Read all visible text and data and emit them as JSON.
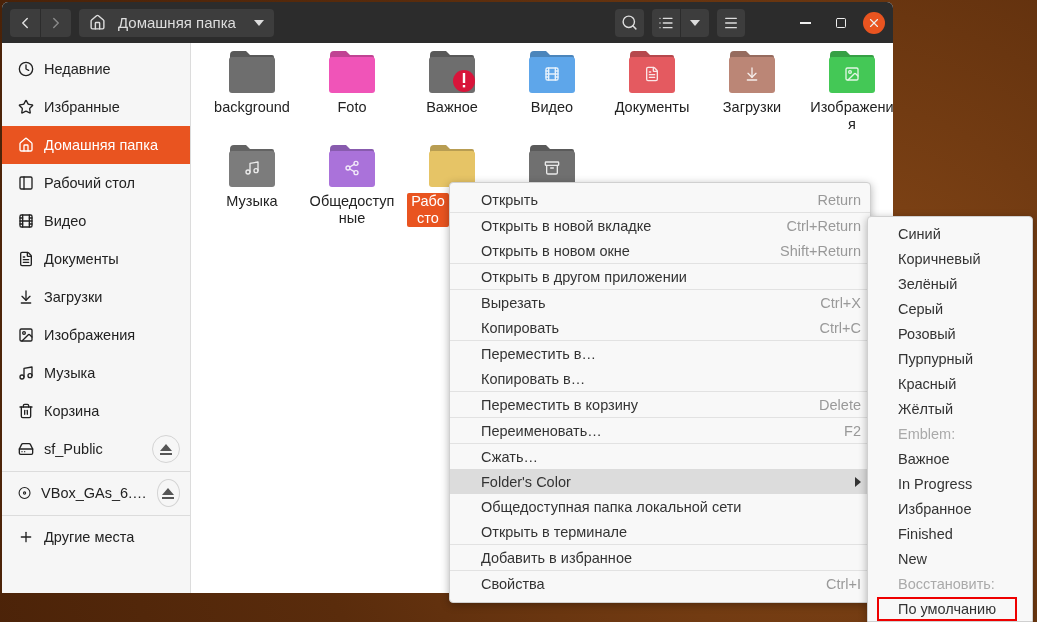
{
  "header": {
    "path": "Домашняя папка"
  },
  "sidebar": {
    "sections": [
      [
        {
          "label": "Недавние",
          "selected": false,
          "eject": false
        },
        {
          "label": "Избранные",
          "selected": false,
          "eject": false
        },
        {
          "label": "Домашняя папка",
          "selected": true,
          "eject": false
        },
        {
          "label": "Рабочий стол",
          "selected": false,
          "eject": false
        },
        {
          "label": "Видео",
          "selected": false,
          "eject": false
        },
        {
          "label": "Документы",
          "selected": false,
          "eject": false
        },
        {
          "label": "Загрузки",
          "selected": false,
          "eject": false
        },
        {
          "label": "Изображения",
          "selected": false,
          "eject": false
        },
        {
          "label": "Музыка",
          "selected": false,
          "eject": false
        },
        {
          "label": "Корзина",
          "selected": false,
          "eject": false
        },
        {
          "label": "sf_Public",
          "selected": false,
          "eject": true
        }
      ],
      [
        {
          "label": "VBox_GAs_6.…",
          "selected": false,
          "eject": true
        }
      ],
      [
        {
          "label": "Другие места",
          "selected": false,
          "eject": false
        }
      ]
    ]
  },
  "folders": [
    {
      "label": "background",
      "color": "#6e6e6e",
      "selected": false,
      "emblem": false
    },
    {
      "label": "Foto",
      "color": "#f054b8",
      "selected": false,
      "emblem": false
    },
    {
      "label": "Важное",
      "color": "#6e6e6e",
      "selected": false,
      "emblem": true
    },
    {
      "label": "Видео",
      "color": "#5ea6ea",
      "selected": false,
      "emblem": false
    },
    {
      "label": "Документы",
      "color": "#e45a60",
      "selected": false,
      "emblem": false
    },
    {
      "label": "Загрузки",
      "color": "#bb8676",
      "selected": false,
      "emblem": false
    },
    {
      "label": "Изображения",
      "color": "#44c856",
      "selected": false,
      "emblem": false
    },
    {
      "label": "Музыка",
      "color": "#7c7c7c",
      "selected": false,
      "emblem": false
    },
    {
      "label": "Общедоступные",
      "color": "#aa72da",
      "selected": false,
      "emblem": false
    },
    {
      "label": "Рабо сто",
      "color": "#e6c466",
      "selected": true,
      "emblem": false
    },
    {
      "color": "#707070",
      "emblem": false
    }
  ],
  "context_menu": {
    "groups": [
      [
        {
          "label": "Открыть",
          "shortcut": "Return",
          "selected": false,
          "submenu": false
        }
      ],
      [
        {
          "label": "Открыть в новой вкладке",
          "shortcut": "Ctrl+Return",
          "selected": false,
          "submenu": false
        },
        {
          "label": "Открыть в новом окне",
          "shortcut": "Shift+Return",
          "selected": false,
          "submenu": false
        }
      ],
      [
        {
          "label": "Открыть в другом приложении",
          "selected": false,
          "submenu": false
        }
      ],
      [
        {
          "label": "Вырезать",
          "shortcut": "Ctrl+X",
          "selected": false,
          "submenu": false
        },
        {
          "label": "Копировать",
          "shortcut": "Ctrl+C",
          "selected": false,
          "submenu": false
        }
      ],
      [
        {
          "label": "Переместить в…",
          "selected": false,
          "submenu": false
        },
        {
          "label": "Копировать в…",
          "selected": false,
          "submenu": false
        }
      ],
      [
        {
          "label": "Переместить в корзину",
          "shortcut": "Delete",
          "selected": false,
          "submenu": false
        }
      ],
      [
        {
          "label": "Переименовать…",
          "shortcut": "F2",
          "selected": false,
          "submenu": false
        }
      ],
      [
        {
          "label": "Сжать…",
          "selected": false,
          "submenu": false
        },
        {
          "label": "Folder's Color",
          "selected": true,
          "submenu": true
        },
        {
          "label": "Общедоступная папка локальной сети",
          "selected": false,
          "submenu": false
        },
        {
          "label": "Открыть в терминале",
          "selected": false,
          "submenu": false
        }
      ],
      [
        {
          "label": "Добавить в избранное",
          "selected": false,
          "submenu": false
        }
      ],
      [
        {
          "label": "Свойства",
          "shortcut": "Ctrl+I",
          "selected": false,
          "submenu": false
        }
      ]
    ]
  },
  "submenu": {
    "items": [
      {
        "label": "Синий",
        "kind": "option",
        "outlined": false
      },
      {
        "label": "Коричневый",
        "kind": "option",
        "outlined": false
      },
      {
        "label": "Зелёный",
        "kind": "option",
        "outlined": false
      },
      {
        "label": "Серый",
        "kind": "option",
        "outlined": false
      },
      {
        "label": "Розовый",
        "kind": "option",
        "outlined": false
      },
      {
        "label": "Пурпурный",
        "kind": "option",
        "outlined": false
      },
      {
        "label": "Красный",
        "kind": "option",
        "outlined": false
      },
      {
        "label": "Жёлтый",
        "kind": "option",
        "outlined": false
      },
      {
        "label": "Emblem:",
        "kind": "header",
        "outlined": false
      },
      {
        "label": "Важное",
        "kind": "option",
        "outlined": false
      },
      {
        "label": "In Progress",
        "kind": "option",
        "outlined": false
      },
      {
        "label": "Избранное",
        "kind": "option",
        "outlined": false
      },
      {
        "label": "Finished",
        "kind": "option",
        "outlined": false
      },
      {
        "label": "New",
        "kind": "option",
        "outlined": false
      },
      {
        "label": "Восстановить:",
        "kind": "header",
        "outlined": false
      },
      {
        "label": "По умолчанию",
        "kind": "option",
        "outlined": true
      }
    ]
  }
}
